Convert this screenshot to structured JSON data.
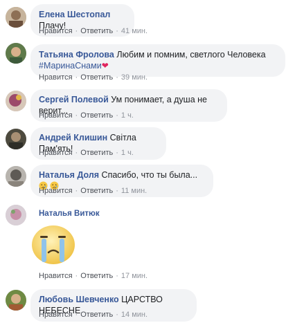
{
  "actions": {
    "like": "Нравится",
    "reply": "Ответить",
    "separator": "·"
  },
  "comments": [
    {
      "author": "Елена Шестопал",
      "text": "Плачу!",
      "time": "41 мин."
    },
    {
      "author": "Татьяна Фролова",
      "text": "Любим и помним, светлого Человека",
      "hashtag": "#МаринаСнами",
      "time": "39 мин."
    },
    {
      "author": "Сергей Полевой",
      "text": "Ум понимает, а душа не верит...",
      "time": "1 ч."
    },
    {
      "author": "Андрей Клишин",
      "text": "Світла Пам'ять!",
      "time": "1 ч."
    },
    {
      "author": "Наталья Доля",
      "text": "Спасибо, что ты была...",
      "time": "11 мин."
    },
    {
      "author": "Наталья Витюк",
      "time": "17 мин."
    },
    {
      "author": "Любовь Шевченко",
      "text": "ЦАРСТВО НЕБЕСНЕ",
      "time": "14 мин."
    }
  ],
  "colors": {
    "author": "#385898",
    "bubble": "#f2f3f5",
    "meta": "#90949c",
    "heart": "#e0245e"
  },
  "icons": {
    "heart": "heart-emoji",
    "sad": "sad-face-emoji",
    "sticker": "crying-face-sticker"
  }
}
